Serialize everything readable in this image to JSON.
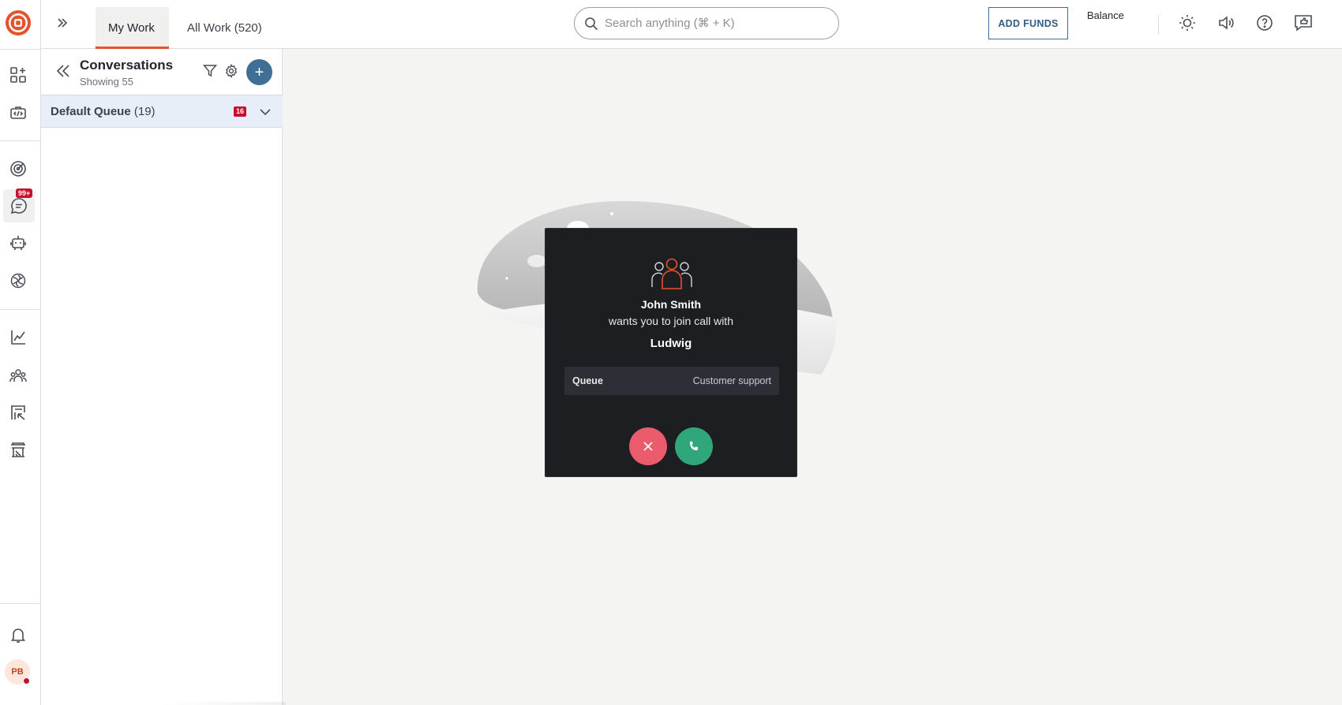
{
  "header": {
    "tabs": [
      {
        "label": "My Work",
        "active": true
      },
      {
        "label": "All Work (520)",
        "active": false
      }
    ],
    "search": {
      "placeholder": "Search anything (⌘ + K)"
    },
    "add_funds_label": "ADD FUNDS",
    "balance_label": "Balance",
    "icons": [
      "theme-icon",
      "speaker-icon",
      "help-icon",
      "feedback-icon"
    ]
  },
  "rail": {
    "items": [
      {
        "icon": "apps-icon"
      },
      {
        "icon": "developer-icon"
      },
      {
        "icon": "target-icon"
      },
      {
        "icon": "chat-icon",
        "active": true,
        "badge": "99+"
      },
      {
        "icon": "bot-icon"
      },
      {
        "icon": "ai-icon"
      },
      {
        "icon": "analytics-icon"
      },
      {
        "icon": "team-icon"
      },
      {
        "icon": "reports-icon"
      },
      {
        "icon": "store-icon"
      },
      {
        "icon": "bell-icon"
      }
    ],
    "avatar_initials": "PB"
  },
  "conversations": {
    "title": "Conversations",
    "subtitle": "Showing 55",
    "queue": {
      "name": "Default Queue",
      "count": "(19)",
      "badge": "16"
    }
  },
  "call_modal": {
    "caller": "John Smith",
    "message": "wants you to join call with",
    "callee": "Ludwig",
    "info_key": "Queue",
    "info_value": "Customer support"
  },
  "colors": {
    "accent": "#e5532d",
    "primary": "#3f6f95",
    "badge": "#c8102e",
    "accept": "#2fa77a",
    "decline": "#ea5c6c",
    "modal_bg": "#1c1e22"
  }
}
